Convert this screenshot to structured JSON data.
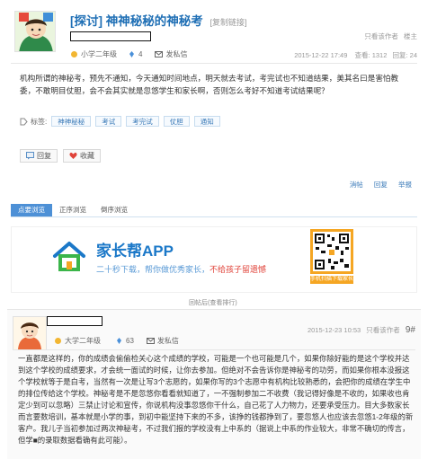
{
  "post": {
    "tag": "[探讨]",
    "title": "神神秘秘的神秘考",
    "copy_link": "[复制链接]",
    "author_meta": {
      "grade": "小学二年级",
      "count": "4",
      "send_msg": "发私信"
    },
    "view_by": "只看该作者",
    "floor_owner": "楼主",
    "date": "2015-12-22 17:49",
    "views_label": "查看:",
    "views": "1312",
    "replies_label": "回复:",
    "replies": "24",
    "content": "机构所谓的神秘考，预先不通知，今天通知时间地点，明天就去考试，考完试也不知道结果，美其名曰是害怕教委，不敢明目仗胆，会不会其实就是忽悠学生和家长啊，否则怎么考好不知道考试结果呢？",
    "tags_label": "标签:",
    "tags": [
      "神神秘秘",
      "考试",
      "考完试",
      "仗胆",
      "通知"
    ],
    "reply_button": "回复",
    "fav_button": "收藏",
    "actions": [
      "消帖",
      "回复",
      "举报"
    ]
  },
  "view_tabs": [
    "点要浏览",
    "正序浏览",
    "倒序浏览"
  ],
  "banner": {
    "app_title": "家长帮APP",
    "app_sub_a": "二十秒下载，帮你做优秀家长，",
    "app_sub_b": "不给孩子留遗憾",
    "qr_caption": "手机扫描下载家长帮APP"
  },
  "separator": "回帖后(查看排行)",
  "reply": {
    "grade": "大学二年级",
    "count": "63",
    "send_msg": "发私信",
    "date": "2015-12-23 10:53",
    "view_by": "只看该作者",
    "floor": "9#",
    "content": "一直都是这样的，你的成绩会偷偷检关心这个成绩的学校，可能是一个也可能是几个，如果你除好能的是这个学校并达到这个学校的成绩要求，才会统一面试的时候，让你去参加。但绝对不会告诉你是神秘考的功劳，而如果你根本没报这个学校就等于是白考，当然有一次是让写3个志愿的，如果你写的3个志愿中有机构比较熟悉的，会把你的成绩在学生中的排位传给这个学校。神秘考是不是忽悠你看看就知道了，一不强制参加二不收费（我记得好像是不收的，如果收也肯定少到可以忽略）三禁止讨论和宣传，你说机构没事忽悠你干什么，自己花了人力物力，还要承受压力。目大多数家长而言要数培训，基本就是小学的事，到初中能坚持下来的不多，该挣的钱都挣到了，要忽悠人也应该去忽悠1-2年级的新客户。我儿子当初参加过两次神秘考，不过我们报的学校没有上中系的（据说上中系的作业较大，非常不确切的传言，但学■的录取数据看确有此可能）。"
  }
}
